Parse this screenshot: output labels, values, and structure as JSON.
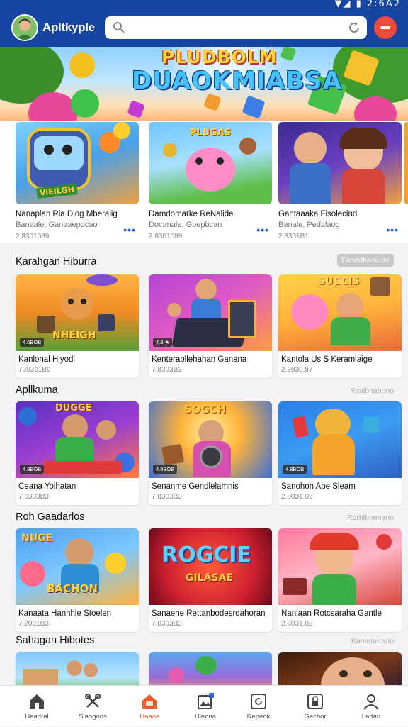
{
  "status": {
    "icons": "▼◢ ▮ ",
    "clock": "2:6A2"
  },
  "header": {
    "app_title": "Apltkyple",
    "search_placeholder": ""
  },
  "banner": {
    "line1": "PLUDBOLM",
    "line2": "DUAOKMIABSA"
  },
  "featured": [
    {
      "title": "Nanaplan Ria Diog Mberalig",
      "subtitle": "Banaale, Ganaaepocao",
      "size": "2.8301089",
      "art": "ViEILGH"
    },
    {
      "title": "Damdomarke ReNalide",
      "subtitle": "Docanale, Gbepbcan",
      "size": "2.8301089",
      "art": "PLUGAS"
    },
    {
      "title": "Gantaaaka Fisolecind",
      "subtitle": "Banale, Pedalaog",
      "size": "2.8301B1",
      "art": ""
    }
  ],
  "sections": [
    {
      "title": "Karahgan Hiburra",
      "action": "Fanedhacarde",
      "cards": [
        {
          "title": "Kanlonal Hlyodl",
          "size": "720301B9",
          "badge": "4.6BOB",
          "art": "NHEIGH"
        },
        {
          "title": "Kenterapllehahan Ganana",
          "size": "7.8303B3",
          "badge": "4.8 ★",
          "art": ""
        },
        {
          "title": "Kantola Us S Keramlaige",
          "size": "2.8930.87",
          "badge": "",
          "art": "SUGCIS"
        }
      ]
    },
    {
      "title": "Apllkuma",
      "action": "Ravibnanono",
      "cards": [
        {
          "title": "Ceana Yolhatan",
          "size": "7.6303B3",
          "badge": "4.8BOB",
          "art": "DUGGE"
        },
        {
          "title": "Senanme Gendlelamnis",
          "size": "7.8303B3",
          "badge": "4.8BOB",
          "art": "SOGCH"
        },
        {
          "title": "Sanohon Ape Sleam",
          "size": "2.8031.03",
          "badge": "4.8BOB",
          "art": ""
        }
      ]
    },
    {
      "title": "Roh Gaadarlos",
      "action": "Rarhlbnenano",
      "cards": [
        {
          "title": "Kanaata Hanhhle Stoelen",
          "size": "7.2001B3",
          "badge": "",
          "art": "BACHON"
        },
        {
          "title": "Sanaene Rettanbodesrdahoran",
          "size": "7.8303B3",
          "badge": "",
          "art": "ROGCIE"
        },
        {
          "title": "Nanlaan Rotcsaraha Gantle",
          "size": "2.8031.82",
          "badge": "",
          "art": ""
        }
      ]
    },
    {
      "title": "Sahagan Hibotes",
      "action": "Karsenarario",
      "cards": [
        {},
        {},
        {}
      ]
    }
  ],
  "nav": [
    {
      "label": "Haadral",
      "icon": "home-icon"
    },
    {
      "label": "Siaogons",
      "icon": "tools-icon"
    },
    {
      "label": "Haaos",
      "icon": "home-orange-icon",
      "active": true
    },
    {
      "label": "Uleona",
      "icon": "image-icon"
    },
    {
      "label": "Repeok",
      "icon": "refresh-icon"
    },
    {
      "label": "Gecbor",
      "icon": "lock-icon"
    },
    {
      "label": "Lattan",
      "icon": "user-icon"
    }
  ],
  "colors": {
    "primary": "#1746a2",
    "accent": "#f05a2a",
    "menu_button": "#f04a3a"
  }
}
